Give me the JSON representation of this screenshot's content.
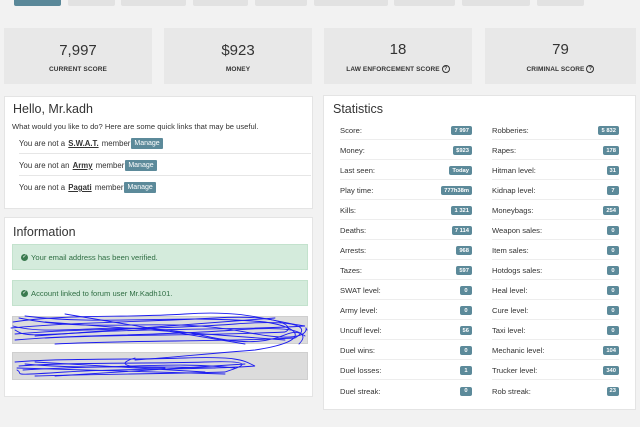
{
  "score_cards": [
    {
      "value": "7,997",
      "label": "CURRENT SCORE",
      "help": false
    },
    {
      "value": "$923",
      "label": "MONEY",
      "help": false
    },
    {
      "value": "18",
      "label": "LAW ENFORCEMENT SCORE",
      "help": true
    },
    {
      "value": "79",
      "label": "CRIMINAL SCORE",
      "help": true
    }
  ],
  "hello": {
    "title": "Hello, Mr.kadh",
    "intro": "What would you like to do? Here are some quick links that may be useful.",
    "manage_label": "Manage",
    "memberships": [
      {
        "prefix": "You are not a",
        "org": "S.W.A.T.",
        "suffix": "member"
      },
      {
        "prefix": "You are not an",
        "org": "Army",
        "suffix": "member"
      },
      {
        "prefix": "You are not a",
        "org": "Pagati",
        "suffix": "member"
      }
    ]
  },
  "information": {
    "title": "Information",
    "alerts": [
      "Your email address has been verified.",
      "Account linked to forum user Mr.Kadh101."
    ]
  },
  "statistics": {
    "title": "Statistics",
    "left": [
      {
        "label": "Score:",
        "value": "7 997"
      },
      {
        "label": "Money:",
        "value": "$923"
      },
      {
        "label": "Last seen:",
        "value": "Today"
      },
      {
        "label": "Play time:",
        "value": "777h38m"
      },
      {
        "label": "Kills:",
        "value": "1 321"
      },
      {
        "label": "Deaths:",
        "value": "7 114"
      },
      {
        "label": "Arrests:",
        "value": "968"
      },
      {
        "label": "Tazes:",
        "value": "597"
      },
      {
        "label": "SWAT level:",
        "value": "0"
      },
      {
        "label": "Army level:",
        "value": "0"
      },
      {
        "label": "Uncuff level:",
        "value": "56"
      },
      {
        "label": "Duel wins:",
        "value": "0"
      },
      {
        "label": "Duel losses:",
        "value": "1"
      },
      {
        "label": "Duel streak:",
        "value": "0"
      }
    ],
    "right": [
      {
        "label": "Robberies:",
        "value": "5 832"
      },
      {
        "label": "Rapes:",
        "value": "178"
      },
      {
        "label": "Hitman level:",
        "value": "31"
      },
      {
        "label": "Kidnap level:",
        "value": "7"
      },
      {
        "label": "Moneybags:",
        "value": "254"
      },
      {
        "label": "Weapon sales:",
        "value": "0"
      },
      {
        "label": "Item sales:",
        "value": "0"
      },
      {
        "label": "Hotdogs sales:",
        "value": "0"
      },
      {
        "label": "Heal level:",
        "value": "0"
      },
      {
        "label": "Cure level:",
        "value": "0"
      },
      {
        "label": "Taxi level:",
        "value": "0"
      },
      {
        "label": "Mechanic level:",
        "value": "104"
      },
      {
        "label": "Trucker level:",
        "value": "340"
      },
      {
        "label": "Rob streak:",
        "value": "23"
      }
    ]
  },
  "colors": {
    "accent": "#5c8a9a",
    "success_bg": "#d4ebdc",
    "success_text": "#2f6e43",
    "scribble": "#1c1cf0"
  }
}
